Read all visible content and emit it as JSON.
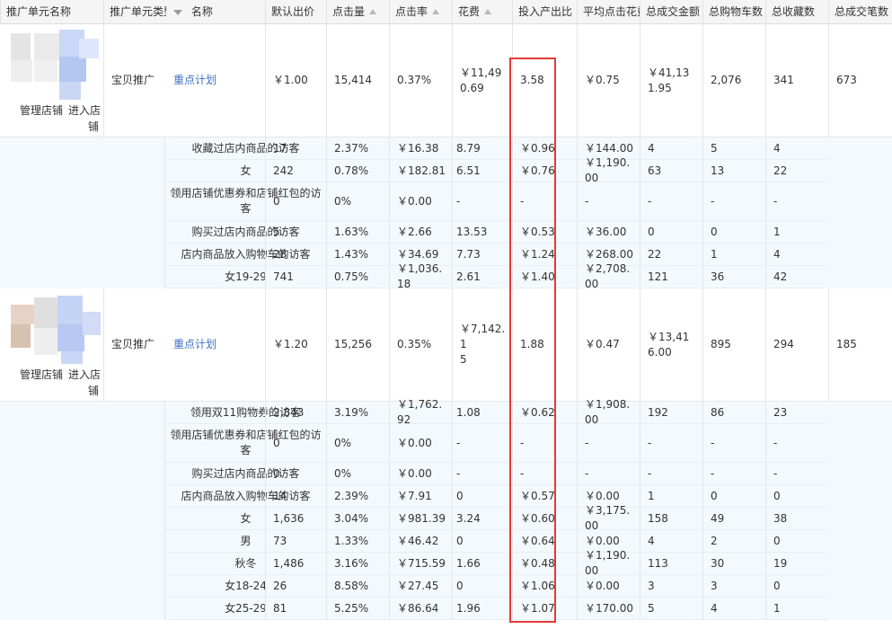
{
  "headers": [
    "推广单元名称",
    "推广单元类型",
    "名称",
    "默认出价",
    "点击量",
    "点击率",
    "花费",
    "投入产出比",
    "平均点击花费",
    "总成交金额",
    "总购物车数",
    "总收藏数",
    "总成交笔数"
  ],
  "units": [
    {
      "manage_shop": "管理店铺",
      "enter_shop_1": "进入店",
      "enter_shop_2": "铺",
      "type": "宝贝推广",
      "plan": "重点计划",
      "bid": "￥1.00",
      "clicks": "15,414",
      "ctr": "0.37%",
      "cost_1": "￥11,49",
      "cost_2": "0.69",
      "roi": "3.58",
      "cpc": "￥0.75",
      "gmv_1": "￥41,13",
      "gmv_2": "1.95",
      "cart": "2,076",
      "fav": "341",
      "orders": "673",
      "crowds": [
        {
          "name": "收藏过店内商品的访客",
          "clicks": "17",
          "ctr": "2.37%",
          "cost": "￥16.38",
          "roi": "8.79",
          "cpc": "￥0.96",
          "gmv": "￥144.00",
          "cart": "4",
          "fav": "5",
          "orders": "4"
        },
        {
          "name": "女",
          "clicks": "242",
          "ctr": "0.78%",
          "cost": "￥182.81",
          "roi": "6.51",
          "cpc": "￥0.76",
          "gmv": "￥1,190.00",
          "cart": "63",
          "fav": "13",
          "orders": "22"
        },
        {
          "name": "领用店铺优惠券和店铺红包的访客",
          "clicks": "0",
          "ctr": "0%",
          "cost": "￥0.00",
          "roi": "-",
          "cpc": "-",
          "gmv": "-",
          "cart": "-",
          "fav": "-",
          "orders": "-"
        },
        {
          "name": "购买过店内商品的访客",
          "clicks": "5",
          "ctr": "1.63%",
          "cost": "￥2.66",
          "roi": "13.53",
          "cpc": "￥0.53",
          "gmv": "￥36.00",
          "cart": "0",
          "fav": "0",
          "orders": "1"
        },
        {
          "name": "店内商品放入购物车的访客",
          "clicks": "28",
          "ctr": "1.43%",
          "cost": "￥34.69",
          "roi": "7.73",
          "cpc": "￥1.24",
          "gmv": "￥268.00",
          "cart": "22",
          "fav": "1",
          "orders": "4"
        },
        {
          "name": "女19-29",
          "clicks": "741",
          "ctr": "0.75%",
          "cost": "￥1,036.18",
          "roi": "2.61",
          "cpc": "￥1.40",
          "gmv": "￥2,708.00",
          "cart": "121",
          "fav": "36",
          "orders": "42"
        }
      ]
    },
    {
      "manage_shop": "管理店铺",
      "enter_shop_1": "进入店",
      "enter_shop_2": "铺",
      "type": "宝贝推广",
      "plan": "重点计划",
      "bid": "￥1.20",
      "clicks": "15,256",
      "ctr": "0.35%",
      "cost_1": "￥7,142.1",
      "cost_2": "5",
      "roi": "1.88",
      "cpc": "￥0.47",
      "gmv_1": "￥13,41",
      "gmv_2": "6.00",
      "cart": "895",
      "fav": "294",
      "orders": "185",
      "crowds": [
        {
          "name": "领用双11购物券的访客",
          "clicks": "2,843",
          "ctr": "3.19%",
          "cost": "￥1,762.92",
          "roi": "1.08",
          "cpc": "￥0.62",
          "gmv": "￥1,908.00",
          "cart": "192",
          "fav": "86",
          "orders": "23"
        },
        {
          "name": "领用店铺优惠券和店铺红包的访客",
          "clicks": "0",
          "ctr": "0%",
          "cost": "￥0.00",
          "roi": "-",
          "cpc": "-",
          "gmv": "-",
          "cart": "-",
          "fav": "-",
          "orders": "-"
        },
        {
          "name": "购买过店内商品的访客",
          "clicks": "0",
          "ctr": "0%",
          "cost": "￥0.00",
          "roi": "-",
          "cpc": "-",
          "gmv": "-",
          "cart": "-",
          "fav": "-",
          "orders": "-"
        },
        {
          "name": "店内商品放入购物车的访客",
          "clicks": "14",
          "ctr": "2.39%",
          "cost": "￥7.91",
          "roi": "0",
          "cpc": "￥0.57",
          "gmv": "￥0.00",
          "cart": "1",
          "fav": "0",
          "orders": "0"
        },
        {
          "name": "女",
          "clicks": "1,636",
          "ctr": "3.04%",
          "cost": "￥981.39",
          "roi": "3.24",
          "cpc": "￥0.60",
          "gmv": "￥3,175.00",
          "cart": "158",
          "fav": "49",
          "orders": "38"
        },
        {
          "name": "男",
          "clicks": "73",
          "ctr": "1.33%",
          "cost": "￥46.42",
          "roi": "0",
          "cpc": "￥0.64",
          "gmv": "￥0.00",
          "cart": "4",
          "fav": "2",
          "orders": "0"
        },
        {
          "name": "秋冬",
          "clicks": "1,486",
          "ctr": "3.16%",
          "cost": "￥715.59",
          "roi": "1.66",
          "cpc": "￥0.48",
          "gmv": "￥1,190.00",
          "cart": "113",
          "fav": "30",
          "orders": "19"
        },
        {
          "name": "女18-24",
          "clicks": "26",
          "ctr": "8.58%",
          "cost": "￥27.45",
          "roi": "0",
          "cpc": "￥1.06",
          "gmv": "￥0.00",
          "cart": "3",
          "fav": "3",
          "orders": "0"
        },
        {
          "name": "女25-29",
          "clicks": "81",
          "ctr": "5.25%",
          "cost": "￥86.64",
          "roi": "1.96",
          "cpc": "￥1.07",
          "gmv": "￥170.00",
          "cart": "5",
          "fav": "4",
          "orders": "1"
        }
      ]
    }
  ],
  "colors": {
    "link": "#3c72c4",
    "highlight": "#e53935",
    "subrow_bg": "#f4f9fd",
    "header_bg": "#f5f5f5"
  }
}
